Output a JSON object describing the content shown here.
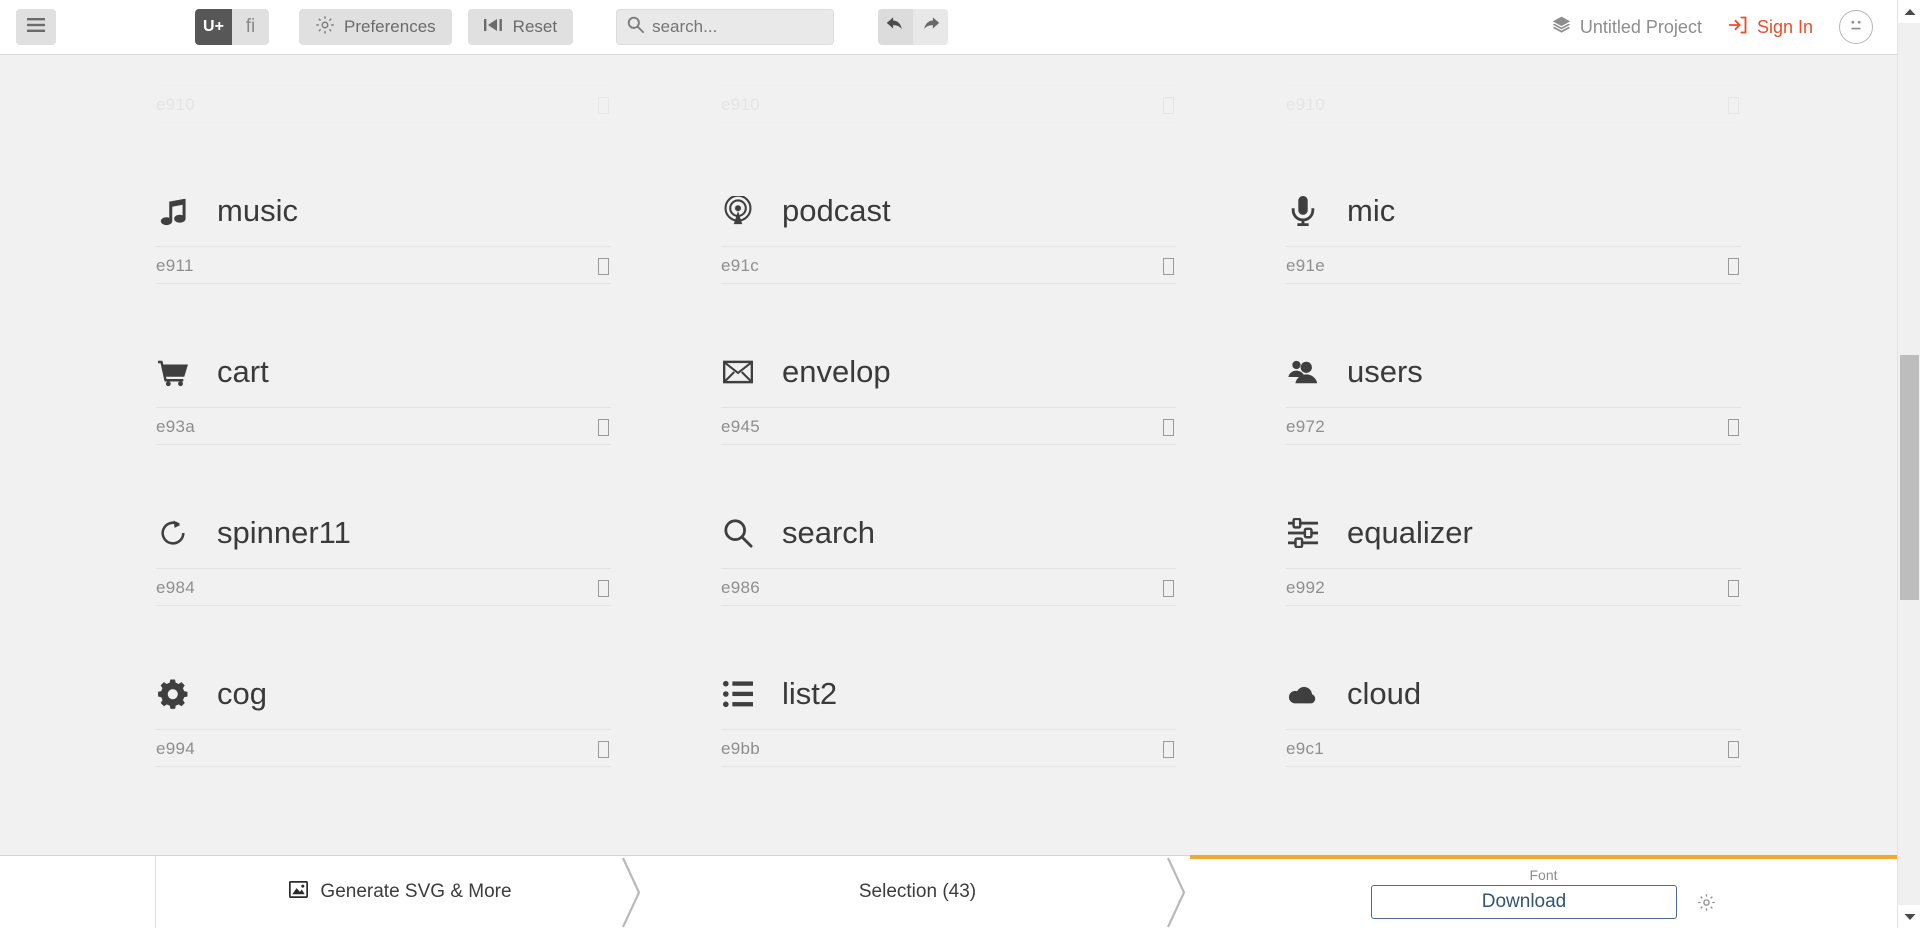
{
  "toolbar": {
    "menu_icon": "hamburger-menu-icon",
    "mode_toggle": {
      "active_label": "U+",
      "inactive_label": "fi"
    },
    "preferences_label": "Preferences",
    "preferences_icon": "gear-icon",
    "reset_label": "Reset",
    "reset_icon": "reset-tab-icon",
    "search": {
      "placeholder": "search...",
      "value": "",
      "icon": "search-icon"
    },
    "undo_icon": "undo-arrow-icon",
    "redo_icon": "redo-arrow-icon",
    "project_label": "Untitled Project",
    "project_icon": "layers-icon",
    "signin_label": "Sign In",
    "signin_icon": "sign-in-icon",
    "avatar_icon": "neutral-face-avatar-icon",
    "accent_color": "#eb4d2a"
  },
  "ghost_row": {
    "code": "e910",
    "tofu": "▯"
  },
  "grid": {
    "items": [
      {
        "name": "music",
        "code": "e911",
        "icon": "music-note-icon",
        "tofu": "▯"
      },
      {
        "name": "podcast",
        "code": "e91c",
        "icon": "podcast-icon",
        "tofu": "▯"
      },
      {
        "name": "mic",
        "code": "e91e",
        "icon": "microphone-icon",
        "tofu": "▯"
      },
      {
        "name": "cart",
        "code": "e93a",
        "icon": "shopping-cart-icon",
        "tofu": "▯"
      },
      {
        "name": "envelop",
        "code": "e945",
        "icon": "envelope-icon",
        "tofu": "▯"
      },
      {
        "name": "users",
        "code": "e972",
        "icon": "users-icon",
        "tofu": "▯"
      },
      {
        "name": "spinner11",
        "code": "e984",
        "icon": "spinner-refresh-icon",
        "tofu": "▯"
      },
      {
        "name": "search",
        "code": "e986",
        "icon": "search-icon",
        "tofu": "▯"
      },
      {
        "name": "equalizer",
        "code": "e992",
        "icon": "equalizer-icon",
        "tofu": "▯"
      },
      {
        "name": "cog",
        "code": "e994",
        "icon": "cog-icon",
        "tofu": "▯"
      },
      {
        "name": "list2",
        "code": "e9bb",
        "icon": "bullet-list-icon",
        "tofu": "▯"
      },
      {
        "name": "cloud",
        "code": "e9c1",
        "icon": "cloud-icon",
        "tofu": "▯"
      }
    ]
  },
  "bottombar": {
    "generate_label": "Generate SVG & More",
    "generate_icon": "image-icon",
    "selection_label": "Selection (43)",
    "font_label": "Font",
    "download_label": "Download",
    "settings_icon": "gear-icon",
    "highlight_color": "#f0a830"
  },
  "scrollbar": {
    "up_icon": "scroll-up-arrow-icon",
    "down_icon": "scroll-down-arrow-icon"
  }
}
